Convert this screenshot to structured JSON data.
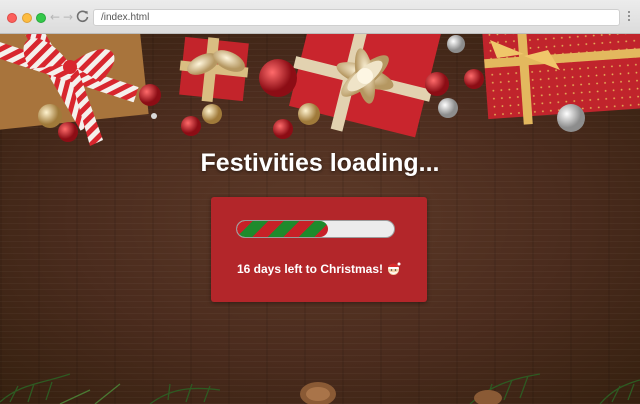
{
  "browser": {
    "url": "/index.html",
    "back_icon": "arrow-left-icon",
    "forward_icon": "arrow-right-icon",
    "reload_icon": "reload-icon",
    "menu_icon": "kebab-menu-icon"
  },
  "page": {
    "title": "Festivities loading...",
    "countdown_text": "16 days left to Christmas!",
    "countdown_icon": "santa-icon",
    "progress": 0.58,
    "colors": {
      "card": "#b3262a",
      "stripe_red": "#c72127",
      "stripe_green": "#1e8a2c",
      "track": "#ececec"
    }
  }
}
